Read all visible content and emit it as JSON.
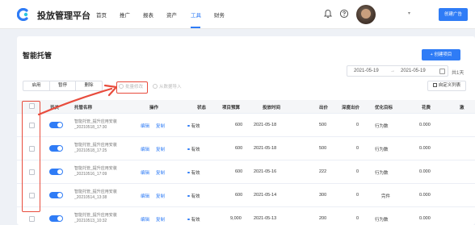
{
  "header": {
    "app_title": "投放管理平台",
    "nav": [
      "首页",
      "推广",
      "报表",
      "资产",
      "工具",
      "财务"
    ],
    "active_nav": "工具",
    "create_ad_label": "创建广告"
  },
  "page": {
    "title": "智能托管",
    "new_button": "+ 创建项目",
    "date_start": "2021-05-19",
    "date_sep": "→",
    "date_end": "2021-05-19",
    "days_label": "共1天",
    "actions": [
      "启用",
      "暂停",
      "删除"
    ],
    "tools": [
      "批量修改",
      "从数据导入"
    ],
    "custom_columns": "自定义列表"
  },
  "table": {
    "columns": [
      "开关",
      "托管名称",
      "操作",
      "状态",
      "项目预算",
      "投放时间",
      "出价",
      "深度出价",
      "优化目标",
      "花费",
      "激"
    ],
    "op_labels": [
      "编辑",
      "复制"
    ],
    "rows": [
      {
        "name": "智能托管_提升应用安装",
        "sub": "_20210518_17:30",
        "status": "有效",
        "budget": "600",
        "time": "2021-05-18",
        "bid": "500",
        "deep_bid": "0",
        "goal": "行为数",
        "spend": "0.000"
      },
      {
        "name": "智能托管_提升应用安装",
        "sub": "_20210518_17:25",
        "status": "有效",
        "budget": "600",
        "time": "2021-05-18",
        "bid": "500",
        "deep_bid": "0",
        "goal": "行为数",
        "spend": "0.000"
      },
      {
        "name": "智能托管_提升应用安装",
        "sub": "_20210516_17:09",
        "status": "有效",
        "budget": "600",
        "time": "2021-05-16",
        "bid": "222",
        "deep_bid": "0",
        "goal": "行为数",
        "spend": "0.000"
      },
      {
        "name": "智能托管_提升应用安装",
        "sub": "_20210514_13:38",
        "status": "有效",
        "budget": "600",
        "time": "2021-05-14",
        "bid": "300",
        "deep_bid": "0",
        "goal": "完件",
        "spend": "0.000"
      },
      {
        "name": "智能托管_提升应用安装",
        "sub": "_20210513_10:32",
        "status": "有效",
        "budget": "9,000",
        "time": "2021-05-13",
        "bid": "200",
        "deep_bid": "0",
        "goal": "行为数",
        "spend": "0.000"
      }
    ]
  },
  "colors": {
    "accent": "#2f7cf6",
    "annotation": "#e84c3d"
  }
}
